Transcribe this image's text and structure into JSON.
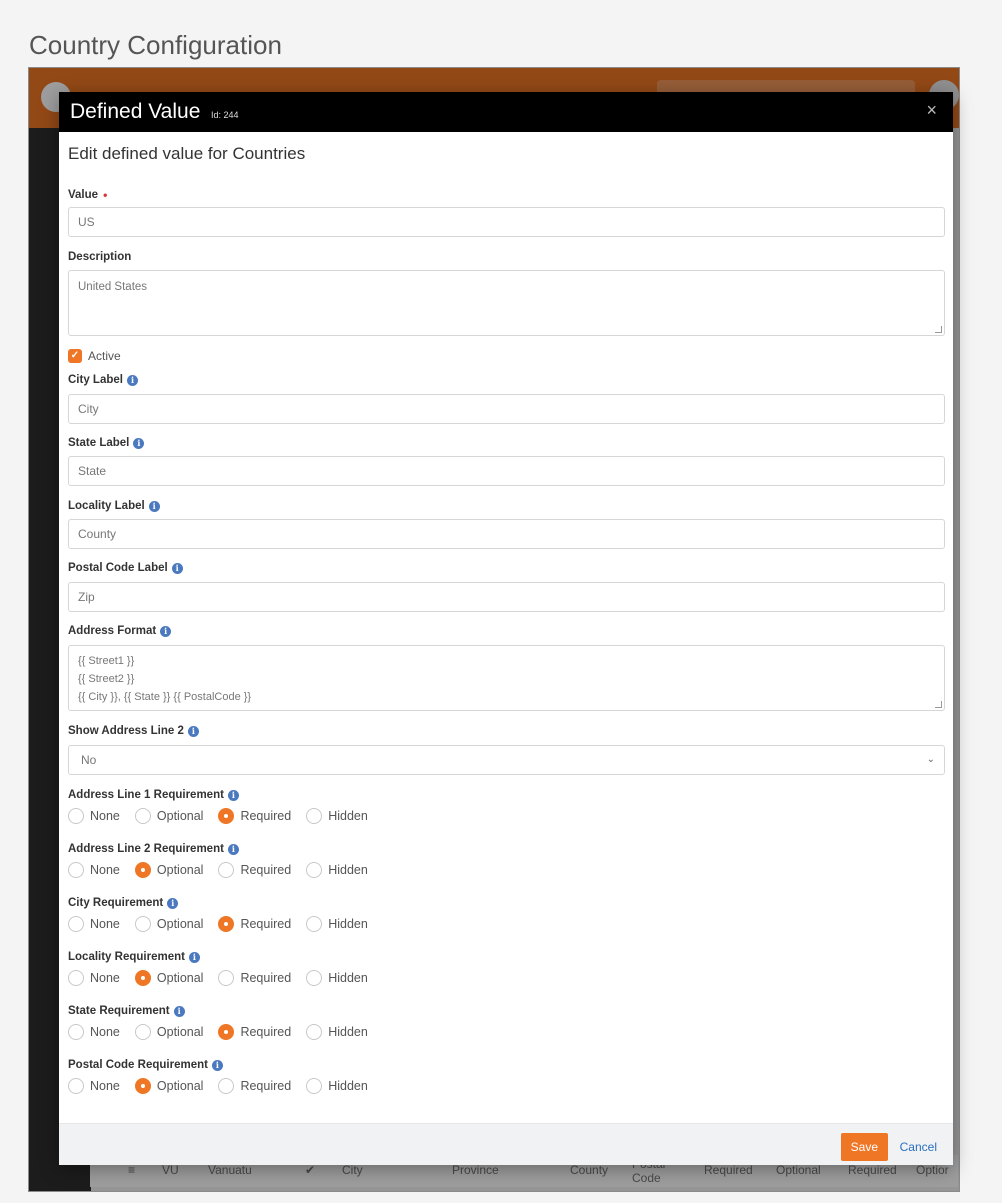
{
  "page": {
    "title": "Country Configuration"
  },
  "background_grid": {
    "row": {
      "code": "VU",
      "name": "Vanuatu",
      "city": "City",
      "state": "Province",
      "locality": "County",
      "postal": "Postal Code",
      "req1": "Required",
      "req2": "Optional",
      "req3": "Required",
      "req4": "Optior"
    }
  },
  "modal": {
    "title": "Defined Value",
    "id_label": "Id: 244",
    "close_label": "×",
    "subtitle": "Edit defined value for Countries",
    "fields": {
      "value": {
        "label": "Value",
        "value": "US"
      },
      "description": {
        "label": "Description",
        "value": "United States"
      },
      "active": {
        "label": "Active"
      },
      "city_label": {
        "label": "City Label",
        "value": "City"
      },
      "state_label": {
        "label": "State Label",
        "value": "State"
      },
      "locality_label": {
        "label": "Locality Label",
        "value": "County"
      },
      "postal_code_label": {
        "label": "Postal Code Label",
        "value": "Zip"
      },
      "address_format": {
        "label": "Address Format",
        "lines": [
          "{{ Street1 }}",
          "{{ Street2 }}",
          "{{ City }}, {{ State }} {{ PostalCode }}"
        ]
      },
      "show_address_line_2": {
        "label": "Show Address Line 2",
        "value": "No"
      }
    },
    "radio_options": [
      "None",
      "Optional",
      "Required",
      "Hidden"
    ],
    "requirements": [
      {
        "label": "Address Line 1 Requirement",
        "selected": "Required"
      },
      {
        "label": "Address Line 2 Requirement",
        "selected": "Optional"
      },
      {
        "label": "City Requirement",
        "selected": "Required"
      },
      {
        "label": "Locality Requirement",
        "selected": "Optional"
      },
      {
        "label": "State Requirement",
        "selected": "Required"
      },
      {
        "label": "Postal Code Requirement",
        "selected": "Optional"
      }
    ],
    "footer": {
      "save": "Save",
      "cancel": "Cancel"
    }
  },
  "colors": {
    "accent": "#ee7625",
    "link": "#2a6fbf",
    "info": "#4a79c0"
  }
}
